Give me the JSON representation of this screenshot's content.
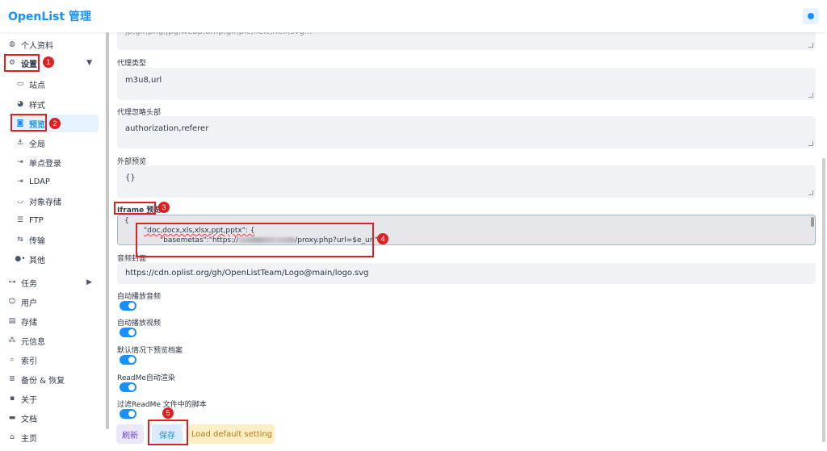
{
  "header": {
    "brand": "OpenList 管理"
  },
  "sidebar": {
    "items": [
      {
        "label": "个人资料",
        "icon": "globe-icon",
        "glyph": "◍"
      },
      {
        "label": "设置",
        "icon": "gear-icon",
        "glyph": "⚙"
      },
      {
        "label": "站点",
        "icon": "window-icon",
        "glyph": "▭"
      },
      {
        "label": "样式",
        "icon": "palette-icon",
        "glyph": "◕"
      },
      {
        "label": "预览",
        "icon": "camera-icon",
        "glyph": "◙"
      },
      {
        "label": "全局",
        "icon": "anchor-icon",
        "glyph": "⚓"
      },
      {
        "label": "单点登录",
        "icon": "login-icon",
        "glyph": "⇥"
      },
      {
        "label": "LDAP",
        "icon": "login-icon",
        "glyph": "⇥"
      },
      {
        "label": "对象存储",
        "icon": "bucket-icon",
        "glyph": "◡"
      },
      {
        "label": "FTP",
        "icon": "server-icon",
        "glyph": "☰"
      },
      {
        "label": "传输",
        "icon": "transfer-icon",
        "glyph": "⇆"
      },
      {
        "label": "其他",
        "icon": "dots-icon",
        "glyph": "●•"
      },
      {
        "label": "任务",
        "icon": "task-icon",
        "glyph": "⊶"
      },
      {
        "label": "用户",
        "icon": "user-icon",
        "glyph": "☺"
      },
      {
        "label": "存储",
        "icon": "storage-icon",
        "glyph": "▤"
      },
      {
        "label": "元信息",
        "icon": "meta-icon",
        "glyph": "⁂"
      },
      {
        "label": "索引",
        "icon": "search-icon",
        "glyph": "⌕"
      },
      {
        "label": "备份 & 恢复",
        "icon": "database-icon",
        "glyph": "≣"
      },
      {
        "label": "关于",
        "icon": "chat-icon",
        "glyph": "▪"
      },
      {
        "label": "文档",
        "icon": "book-icon",
        "glyph": "▬"
      },
      {
        "label": "主页",
        "icon": "home-icon",
        "glyph": "⌂"
      }
    ]
  },
  "main": {
    "top_partial": "jp,gif,png,jpg,webp,bmp,gif,pic,heic,heif,svg...",
    "proxy_types": {
      "label": "代理类型",
      "value": "m3u8,url"
    },
    "proxy_ignore_headers": {
      "label": "代理忽略头部",
      "value": "authorization,referer"
    },
    "external_preview": {
      "label": "外部预览",
      "value": "{}"
    },
    "iframe_preview": {
      "label": "Iframe 预览",
      "line1": "{",
      "line2": "\"doc,docx,xls,xlsx,ppt,pptx\": {",
      "line3_prefix": "\"basemetas\":\"https://",
      "line3_suffix": "/proxy.php?url=$e_url\","
    },
    "audio_cover": {
      "label": "音频封面",
      "value": "https://cdn.oplist.org/gh/OpenListTeam/Logo@main/logo.svg"
    },
    "toggles": [
      {
        "label": "自动播放音频",
        "on": true
      },
      {
        "label": "自动播放视频",
        "on": true
      },
      {
        "label": "默认情况下预览档案",
        "on": true
      },
      {
        "label": "ReadMe自动渲染",
        "on": true
      },
      {
        "label": "过滤ReadMe 文件中的脚本",
        "on": true
      }
    ],
    "buttons": {
      "refresh": "刷新",
      "save": "保存",
      "load_default": "Load default setting"
    }
  },
  "annotations": [
    "1",
    "2",
    "3",
    "4",
    "5"
  ],
  "colors": {
    "accent": "#1890ff",
    "annotation": "#e02020"
  }
}
